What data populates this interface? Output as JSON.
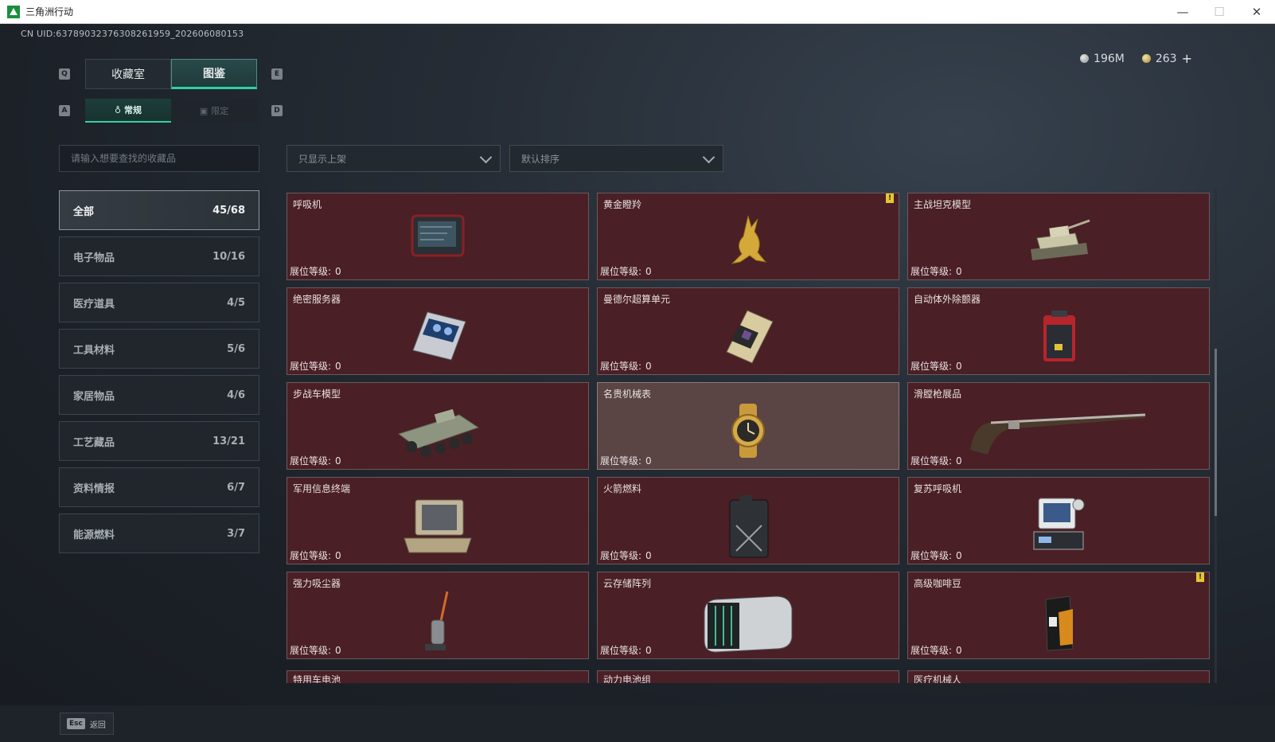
{
  "window": {
    "title": "三角洲行动",
    "min": "—",
    "max": "☐",
    "close": "✕"
  },
  "uid": "CN UID:637890323763082619​59_202606080153",
  "currency": {
    "silver": "196M",
    "gold": "263",
    "plus": "+"
  },
  "keys": {
    "q": "Q",
    "e": "E",
    "a": "A",
    "d": "D"
  },
  "tabs": {
    "collection_room": "收藏室",
    "catalog": "图鉴"
  },
  "subtabs": {
    "regular": "常规",
    "limited": "限定"
  },
  "search": {
    "placeholder": "请输入想要查找的收藏品"
  },
  "filters": {
    "shelf": "只显示上架",
    "sort": "默认排序"
  },
  "categories": [
    {
      "label": "全部",
      "count": "45/68"
    },
    {
      "label": "电子物品",
      "count": "10/16"
    },
    {
      "label": "医疗道具",
      "count": "4/5"
    },
    {
      "label": "工具材料",
      "count": "5/6"
    },
    {
      "label": "家居物品",
      "count": "4/6"
    },
    {
      "label": "工艺藏品",
      "count": "13/21"
    },
    {
      "label": "资料情报",
      "count": "6/7"
    },
    {
      "label": "能源燃料",
      "count": "3/7"
    }
  ],
  "level_label": "展位等级:",
  "items": [
    {
      "name": "呼吸机",
      "level": "0",
      "icon": "ventilator-icon"
    },
    {
      "name": "黄金瞪羚",
      "level": "0",
      "icon": "golden-gazelle-icon",
      "badge": "!"
    },
    {
      "name": "主战坦克模型",
      "level": "0",
      "icon": "tank-model-icon"
    },
    {
      "name": "绝密服务器",
      "level": "0",
      "icon": "server-icon"
    },
    {
      "name": "曼德尔超算单元",
      "level": "0",
      "icon": "supercomputer-unit-icon"
    },
    {
      "name": "自动体外除颤器",
      "level": "0",
      "icon": "defibrillator-icon"
    },
    {
      "name": "步战车模型",
      "level": "0",
      "icon": "ifv-model-icon"
    },
    {
      "name": "名贵机械表",
      "level": "0",
      "icon": "watch-icon"
    },
    {
      "name": "滑膛枪展品",
      "level": "0",
      "icon": "musket-icon"
    },
    {
      "name": "军用信息终端",
      "level": "0",
      "icon": "military-terminal-icon"
    },
    {
      "name": "火箭燃料",
      "level": "0",
      "icon": "fuel-can-icon"
    },
    {
      "name": "复苏呼吸机",
      "level": "0",
      "icon": "resuscitator-icon"
    },
    {
      "name": "强力吸尘器",
      "level": "0",
      "icon": "vacuum-icon"
    },
    {
      "name": "云存储阵列",
      "level": "0",
      "icon": "storage-array-icon"
    },
    {
      "name": "高级咖啡豆",
      "level": "0",
      "icon": "coffee-beans-icon",
      "badge": "!"
    }
  ],
  "partial_items": [
    "特用车电池",
    "动力电池组",
    "医疗机械人"
  ],
  "footer": {
    "esc_key": "Esc",
    "back": "返回"
  }
}
